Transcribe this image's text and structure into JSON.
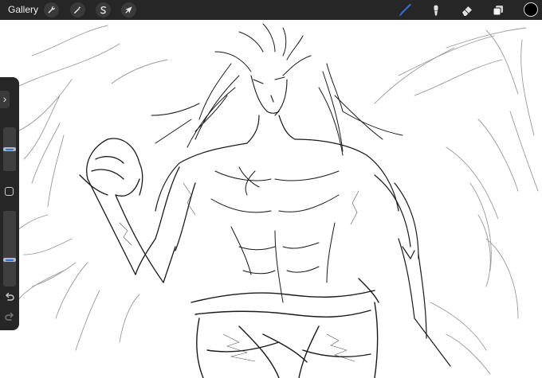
{
  "toolbar": {
    "gallery_label": "Gallery",
    "actions": [
      {
        "name": "actions",
        "icon": "wrench-icon"
      },
      {
        "name": "adjustments",
        "icon": "magic-wand-icon"
      },
      {
        "name": "selection",
        "icon": "selection-s-icon"
      },
      {
        "name": "transform",
        "icon": "arrow-cursor-icon"
      }
    ],
    "tools": [
      {
        "name": "brush",
        "icon": "brush-icon",
        "active": true
      },
      {
        "name": "smudge",
        "icon": "smudge-icon",
        "active": false
      },
      {
        "name": "eraser",
        "icon": "eraser-icon",
        "active": false
      },
      {
        "name": "layers",
        "icon": "layers-icon",
        "active": false
      }
    ],
    "active_color": "#000000",
    "accent_color": "#2f6fd8"
  },
  "sidebar": {
    "expand_icon": "chevron-right-icon",
    "brush_size_level": 0.5,
    "opacity_level": 0.25,
    "modify_icon": "square-icon",
    "undo_icon": "undo-icon",
    "redo_icon": "redo-icon"
  },
  "canvas": {
    "content": "pencil-sketch"
  }
}
